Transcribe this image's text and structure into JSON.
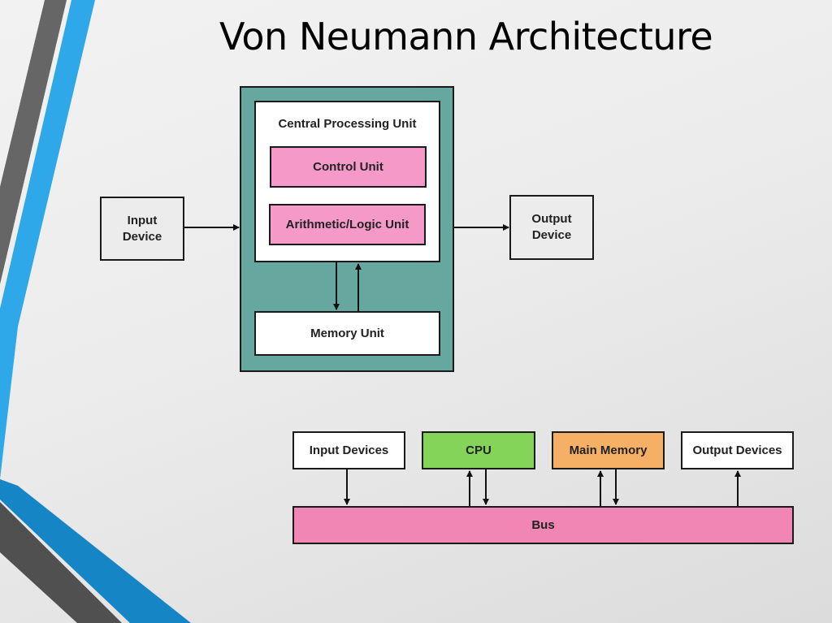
{
  "title": "Von Neumann Architecture",
  "top_diagram": {
    "input_device": "Input\nDevice",
    "output_device": "Output\nDevice",
    "cpu_label": "Central Processing Unit",
    "control_unit": "Control Unit",
    "alu": "Arithmetic/Logic Unit",
    "memory_unit": "Memory Unit"
  },
  "bus_diagram": {
    "input_devices": "Input Devices",
    "cpu": "CPU",
    "main_memory": "Main Memory",
    "output_devices": "Output Devices",
    "bus": "Bus"
  },
  "colors": {
    "teal": "#66a8a0",
    "pink": "#f59ac8",
    "cpu_green": "#84d45a",
    "memory_orange": "#f6b066",
    "bus_pink": "#f186b4",
    "accent_blue": "#2ea8e8",
    "accent_gray": "#666666"
  }
}
